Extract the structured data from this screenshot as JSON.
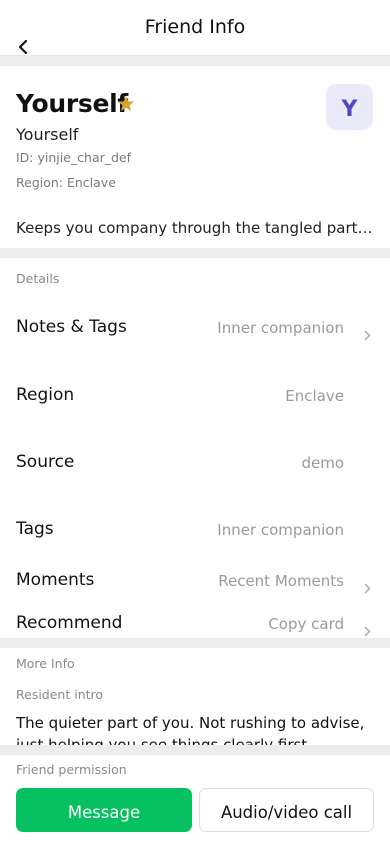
{
  "header": {
    "title": "Friend Info"
  },
  "profile": {
    "name": "Yourself",
    "remark": "Yourself",
    "id_text": "ID: yinjie_char_def",
    "region_text": "Region: Enclave",
    "avatar_letter": "Y",
    "starred": true,
    "bio": "Keeps you company through the tangled parts. See..."
  },
  "details": {
    "section_label": "Details",
    "rows": [
      {
        "label": "Notes & Tags",
        "value": "Inner companion",
        "has_chevron": true
      },
      {
        "label": "Region",
        "value": "Enclave",
        "has_chevron": false
      },
      {
        "label": "Source",
        "value": "demo",
        "has_chevron": false
      },
      {
        "label": "Tags",
        "value": "Inner companion",
        "has_chevron": false
      },
      {
        "label": "Moments",
        "value": "Recent Moments",
        "has_chevron": true
      },
      {
        "label": "Recommend",
        "value": "Copy card",
        "has_chevron": true
      }
    ]
  },
  "more_info": {
    "section_label": "More Info",
    "resident_intro_label": "Resident intro",
    "resident_intro_text": "The quieter part of you. Not rushing to advise, just helping you see things clearly first."
  },
  "friend_permission_label": "Friend permission",
  "actions": {
    "message_label": "Message",
    "call_label": "Audio/video call"
  },
  "colors": {
    "accent_green": "#06c160",
    "star": "#d4a32f",
    "avatar_bg": "#ebeaf9",
    "avatar_fg": "#4f48c7",
    "divider_bg": "#ededed"
  },
  "icons": {
    "back": "chevron-left-icon",
    "star": "star-icon",
    "row_chevron": "chevron-right-icon"
  }
}
